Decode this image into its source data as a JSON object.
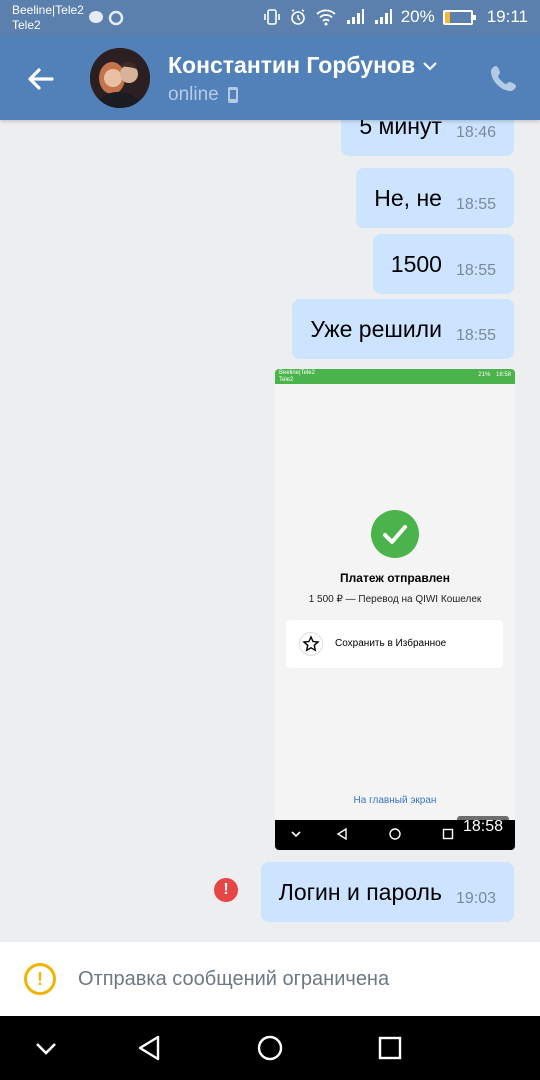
{
  "status_bar": {
    "carrier_line1": "Beeline|Tele2",
    "carrier_line2": "Tele2",
    "battery_percent": "20%",
    "battery_level": 0.2,
    "time": "19:11"
  },
  "header": {
    "contact_name": "Константин Горбунов",
    "status": "online",
    "back_icon": "arrow-left-icon",
    "call_icon": "phone-icon"
  },
  "messages": [
    {
      "text": "5 минут",
      "time": "18:46"
    },
    {
      "text": "Не, не",
      "time": "18:55"
    },
    {
      "text": "1500",
      "time": "18:55"
    },
    {
      "text": "Уже решили",
      "time": "18:55"
    },
    {
      "text": "Логин и пароль",
      "time": "19:03",
      "failed": true
    }
  ],
  "screenshot_message": {
    "time": "18:58",
    "inner_status": {
      "carrier": "Beeline|Tele2",
      "carrier2": "Tele2",
      "battery": "21%",
      "time": "18:58"
    },
    "title": "Платеж отправлен",
    "subtitle": "1 500 ₽ — Перевод на QIWI Кошелек",
    "favorite_label": "Сохранить в Избранное",
    "home_link": "На главный экран"
  },
  "error_icon_text": "!",
  "restriction": {
    "text": "Отправка сообщений ограничена",
    "icon_text": "!"
  },
  "colors": {
    "header": "#5181b8",
    "bubble": "#cce4ff",
    "success": "#4bb34b",
    "error": "#e64646",
    "warning": "#f2b400"
  }
}
